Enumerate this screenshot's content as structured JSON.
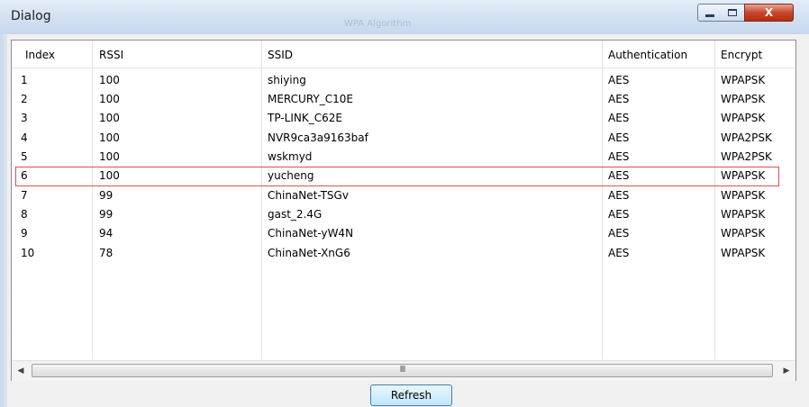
{
  "window": {
    "title": "Dialog",
    "faded_title": "WPA Algorithm"
  },
  "table": {
    "columns": [
      "Index",
      "RSSI",
      "SSID",
      "Authentication",
      "Encrypt"
    ],
    "rows": [
      {
        "index": "1",
        "rssi": "100",
        "ssid": "shiying",
        "auth": "AES",
        "encrypt": "WPAPSK"
      },
      {
        "index": "2",
        "rssi": "100",
        "ssid": "MERCURY_C10E",
        "auth": "AES",
        "encrypt": "WPAPSK"
      },
      {
        "index": "3",
        "rssi": "100",
        "ssid": "TP-LINK_C62E",
        "auth": "AES",
        "encrypt": "WPAPSK"
      },
      {
        "index": "4",
        "rssi": "100",
        "ssid": "NVR9ca3a9163baf",
        "auth": "AES",
        "encrypt": "WPA2PSK"
      },
      {
        "index": "5",
        "rssi": "100",
        "ssid": "wskmyd",
        "auth": "AES",
        "encrypt": "WPA2PSK"
      },
      {
        "index": "6",
        "rssi": "100",
        "ssid": "yucheng",
        "auth": "AES",
        "encrypt": "WPAPSK"
      },
      {
        "index": "7",
        "rssi": "99",
        "ssid": "ChinaNet-TSGv",
        "auth": "AES",
        "encrypt": "WPAPSK"
      },
      {
        "index": "8",
        "rssi": "99",
        "ssid": "gast_2.4G",
        "auth": "AES",
        "encrypt": "WPAPSK"
      },
      {
        "index": "9",
        "rssi": "94",
        "ssid": "ChinaNet-yW4N",
        "auth": "AES",
        "encrypt": "WPAPSK"
      },
      {
        "index": "10",
        "rssi": "78",
        "ssid": "ChinaNet-XnG6",
        "auth": "AES",
        "encrypt": "WPAPSK"
      }
    ],
    "highlighted_row": 6
  },
  "scrollbar": {
    "left_arrow": "◀",
    "right_arrow": "▶",
    "grip": "III"
  },
  "buttons": {
    "refresh": "Refresh",
    "close_glyph": "X"
  },
  "colors": {
    "highlight_border": "#e05050",
    "close_button": "#c7472c"
  }
}
